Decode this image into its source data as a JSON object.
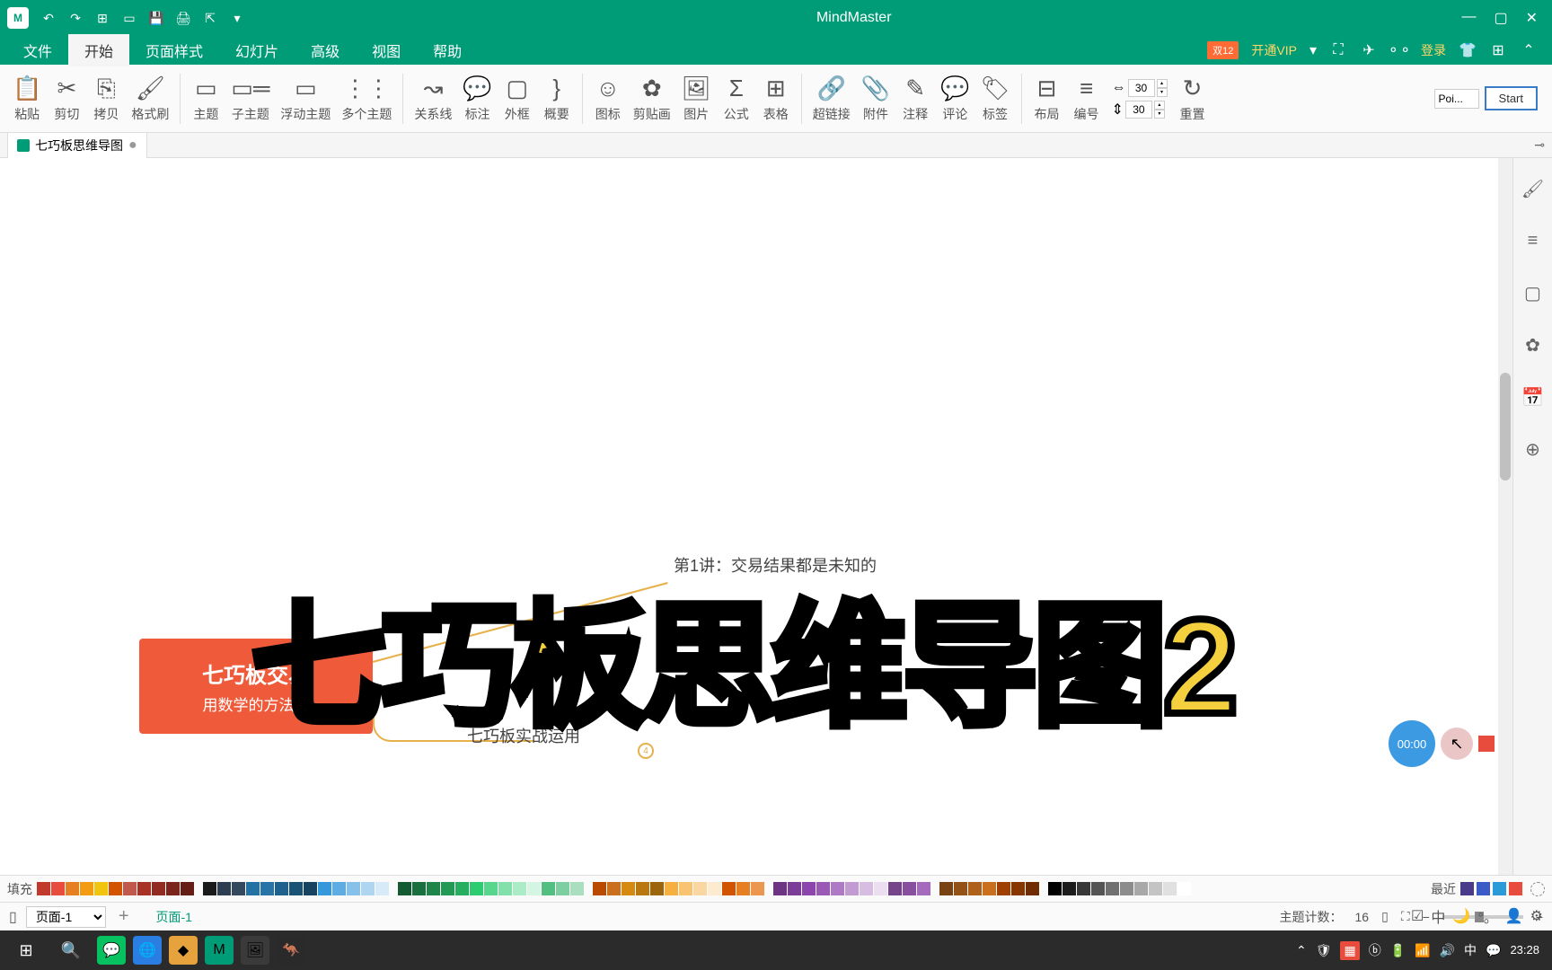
{
  "app": {
    "title": "MindMaster"
  },
  "qat": [
    "undo",
    "redo",
    "new",
    "open",
    "save",
    "print",
    "export",
    "more"
  ],
  "menu": {
    "items": [
      "文件",
      "开始",
      "页面样式",
      "幻灯片",
      "高级",
      "视图",
      "帮助"
    ],
    "active_index": 1,
    "vip_badge": "双12",
    "vip_text": "开通VIP",
    "login": "登录"
  },
  "ribbon": {
    "groups": [
      {
        "id": "paste",
        "label": "粘贴"
      },
      {
        "id": "cut",
        "label": "剪切"
      },
      {
        "id": "copy",
        "label": "拷贝"
      },
      {
        "id": "format-painter",
        "label": "格式刷"
      },
      {
        "id": "topic",
        "label": "主题"
      },
      {
        "id": "subtopic",
        "label": "子主题"
      },
      {
        "id": "floating-topic",
        "label": "浮动主题"
      },
      {
        "id": "multi-topic",
        "label": "多个主题"
      },
      {
        "id": "relationship",
        "label": "关系线"
      },
      {
        "id": "callout",
        "label": "标注"
      },
      {
        "id": "boundary",
        "label": "外框"
      },
      {
        "id": "summary",
        "label": "概要"
      },
      {
        "id": "icon",
        "label": "图标"
      },
      {
        "id": "clipart",
        "label": "剪贴画"
      },
      {
        "id": "picture",
        "label": "图片"
      },
      {
        "id": "formula",
        "label": "公式"
      },
      {
        "id": "table",
        "label": "表格"
      },
      {
        "id": "hyperlink",
        "label": "超链接"
      },
      {
        "id": "attachment",
        "label": "附件"
      },
      {
        "id": "note",
        "label": "注释"
      },
      {
        "id": "comment",
        "label": "评论"
      },
      {
        "id": "tag",
        "label": "标签"
      },
      {
        "id": "layout",
        "label": "布局"
      },
      {
        "id": "numbering",
        "label": "编号"
      },
      {
        "id": "reset",
        "label": "重置"
      }
    ],
    "h_spacing": "30",
    "v_spacing": "30",
    "pointer_input": "Poi...",
    "start_button": "Start"
  },
  "tab": {
    "name": "七巧板思维导图",
    "dirty": true
  },
  "mindmap": {
    "root": {
      "title": "七巧板交易",
      "subtitle": "用数学的方法做"
    },
    "children": [
      {
        "text": "第1讲：交易结果都是未知的"
      },
      {
        "text": "七巧板实战运用"
      }
    ],
    "collapsed_count": "4"
  },
  "overlay": {
    "text": "七巧板思维导图2"
  },
  "recording": {
    "time": "00:00"
  },
  "palette": {
    "fill_label": "填充",
    "recent_label": "最近",
    "recent_colors": [
      "#4a3a8a",
      "#3a5ac8",
      "#2a9ad8",
      "#e74c3c"
    ]
  },
  "pagebar": {
    "page_select": "页面-1",
    "page_tab": "页面-1",
    "topic_count_label": "主题计数：",
    "topic_count": "16"
  },
  "taskbar": {
    "time": "23:28",
    "ime": "中"
  }
}
